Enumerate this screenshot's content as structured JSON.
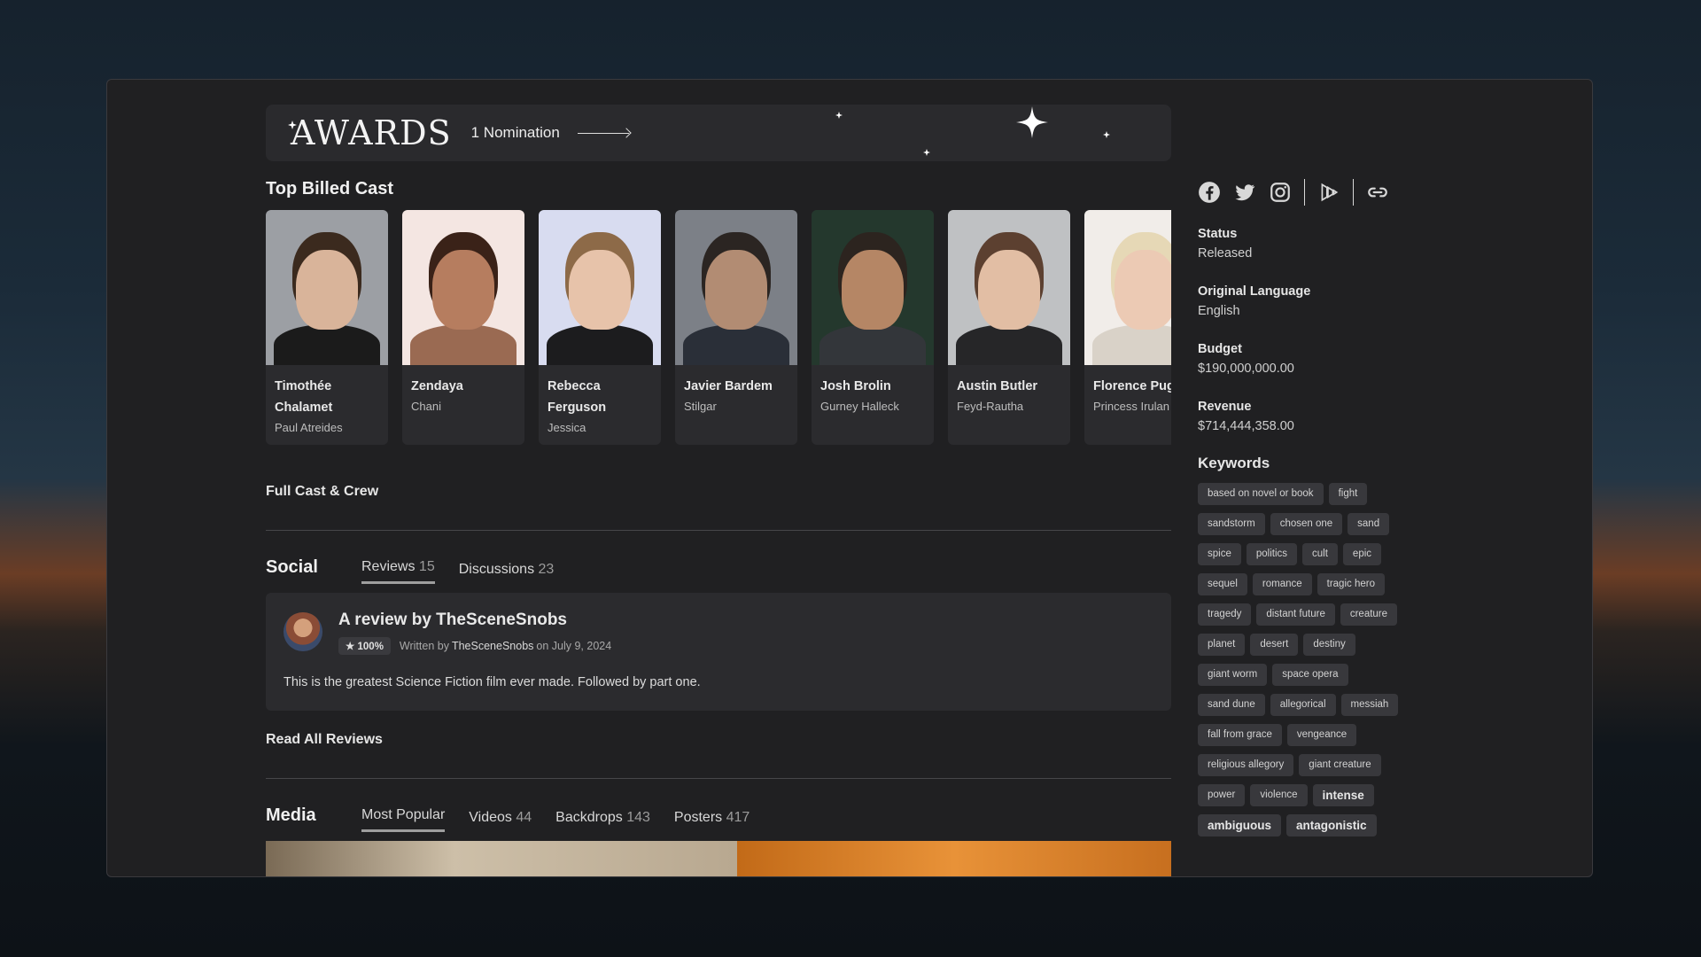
{
  "awards": {
    "title": "AWARDS",
    "count": "1 Nomination"
  },
  "cast": {
    "heading": "Top Billed Cast",
    "members": [
      {
        "name": "Timothée Chalamet",
        "role": "Paul Atreides",
        "bg": "#9c9fa4",
        "skin": "#d9b49a",
        "hair": "#3b2a1e",
        "cloth": "#1b1b1b"
      },
      {
        "name": "Zendaya",
        "role": "Chani",
        "bg": "#f4e6e2",
        "skin": "#b67d5f",
        "hair": "#3a2218",
        "cloth": "#9a6a52"
      },
      {
        "name": "Rebecca Ferguson",
        "role": "Jessica",
        "bg": "#d8dcf0",
        "skin": "#e7c3aa",
        "hair": "#8d6a48",
        "cloth": "#1c1c1e"
      },
      {
        "name": "Javier Bardem",
        "role": "Stilgar",
        "bg": "#7c8087",
        "skin": "#b28c73",
        "hair": "#2b2522",
        "cloth": "#2a2f38"
      },
      {
        "name": "Josh Brolin",
        "role": "Gurney Halleck",
        "bg": "#24382d",
        "skin": "#b58665",
        "hair": "#2c241f",
        "cloth": "#33363a"
      },
      {
        "name": "Austin Butler",
        "role": "Feyd-Rautha",
        "bg": "#bfc1c3",
        "skin": "#e2bea4",
        "hair": "#5c4030",
        "cloth": "#262628"
      },
      {
        "name": "Florence Pugh",
        "role": "Princess Irulan",
        "bg": "#f1ede9",
        "skin": "#eccab4",
        "hair": "#e6d8b6",
        "cloth": "#d9d2c8"
      }
    ],
    "full_link": "Full Cast & Crew"
  },
  "social": {
    "title": "Social",
    "tabs": [
      {
        "label": "Reviews",
        "count": "15"
      },
      {
        "label": "Discussions",
        "count": "23"
      }
    ],
    "review": {
      "title": "A review by TheSceneSnobs",
      "rating": "★ 100%",
      "written_by": "Written by",
      "author": "TheSceneSnobs",
      "date": "on July 9, 2024",
      "body": "This is the greatest Science Fiction film ever made. Followed by part one."
    },
    "read_all": "Read All Reviews"
  },
  "media": {
    "title": "Media",
    "tabs": [
      {
        "label": "Most Popular",
        "count": ""
      },
      {
        "label": "Videos",
        "count": "44"
      },
      {
        "label": "Backdrops",
        "count": "143"
      },
      {
        "label": "Posters",
        "count": "417"
      }
    ]
  },
  "sidebar": {
    "social_icons": [
      "facebook-icon",
      "twitter-icon",
      "instagram-icon",
      "justwatch-icon",
      "homepage-link-icon"
    ],
    "facts": [
      {
        "label": "Status",
        "value": "Released"
      },
      {
        "label": "Original Language",
        "value": "English"
      },
      {
        "label": "Budget",
        "value": "$190,000,000.00"
      },
      {
        "label": "Revenue",
        "value": "$714,444,358.00"
      }
    ],
    "keywords_title": "Keywords",
    "keywords": [
      "based on novel or book",
      "fight",
      "sandstorm",
      "chosen one",
      "sand",
      "spice",
      "politics",
      "cult",
      "epic",
      "sequel",
      "romance",
      "tragic hero",
      "tragedy",
      "distant future",
      "creature",
      "planet",
      "desert",
      "destiny",
      "giant worm",
      "space opera",
      "sand dune",
      "allegorical",
      "messiah",
      "fall from grace",
      "vengeance",
      "religious allegory",
      "giant creature",
      "power",
      "violence",
      "intense",
      "ambiguous",
      "antagonistic"
    ],
    "big_keywords": [
      "intense",
      "ambiguous",
      "antagonistic"
    ]
  }
}
